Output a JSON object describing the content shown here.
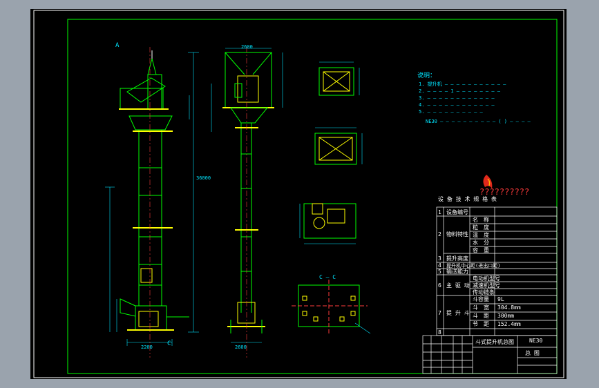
{
  "drawing": {
    "notes_title": "说明：",
    "notes_lines": [
      "1. 提升机 — — — — — — — — — — —",
      "2. — — — — 1 — — — — — — — —",
      "3. — — — — — — — — — — — —",
      "4. — — — — — — — — — — — —",
      "5. — — — — — — — — — —"
    ],
    "notes_formula": "NE30 — — — — — — — — — — ( ) — — — —",
    "company_text": "??????????",
    "tech_table_title": "设 备 技 术 规 格 表",
    "tech_rows": [
      {
        "no": "1",
        "label": "设备编号",
        "sub": [],
        "values": []
      },
      {
        "no": "2",
        "label": "物料特性",
        "sub": [
          "名　称",
          "粒　度",
          "温　度",
          "水　分",
          "容　重"
        ],
        "values": [
          "",
          "",
          "",
          "",
          ""
        ]
      },
      {
        "no": "3",
        "label": "提升高度",
        "sub": [],
        "values": []
      },
      {
        "no": "4",
        "label": "提升机中心距(进出口距)",
        "sub": [],
        "values": []
      },
      {
        "no": "5",
        "label": "输送能力",
        "sub": [],
        "values": []
      },
      {
        "no": "6",
        "label": "主 驱 动",
        "sub": [
          "电动机型号",
          "减速机型号",
          "传动链条"
        ],
        "values": [
          "",
          "",
          ""
        ]
      },
      {
        "no": "7",
        "label": "提 升 斗",
        "sub": [
          "斗容量",
          "斗　宽",
          "斗　距",
          "节　距"
        ],
        "values": [
          "9L",
          "304.8mm",
          "300mm",
          "152.4mm"
        ]
      },
      {
        "no": "8",
        "label": "",
        "sub": [],
        "values": []
      }
    ],
    "title_block": {
      "title": "斗式提升机总图",
      "model": "NE30",
      "drawing_type": "总 图"
    },
    "dim_labels": {
      "view_a": "A",
      "view_c": "C",
      "section": "C — C",
      "height_total": "36000",
      "width_top": "2600",
      "foot_a": "2600",
      "foot_b": "2200"
    }
  },
  "colors": {
    "frame": "#00ff00",
    "structure": "#00ff00",
    "dim": "#00e5ff",
    "detail": "#ffff00",
    "center": "#ff3b3b",
    "text": "#ffffff"
  }
}
